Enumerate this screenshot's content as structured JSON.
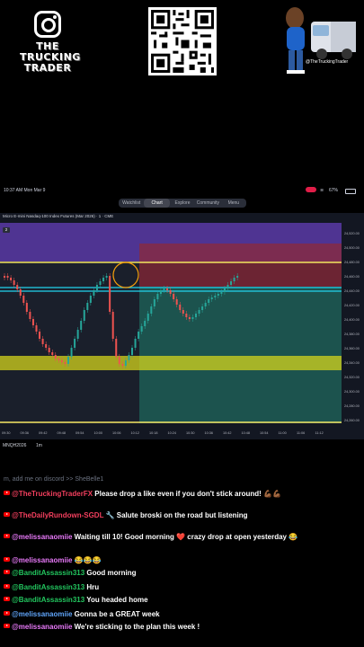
{
  "brand": {
    "line1": "THE",
    "line2": "TRUCKING",
    "line3": "TRADER",
    "handle": "@TheTruckingTrader"
  },
  "status_bar": {
    "time": "10:37 AM  Mon Mar 9",
    "battery": "67%"
  },
  "nav": {
    "tabs": [
      "Watchlist",
      "Chart",
      "Explore",
      "Community",
      "Menu"
    ],
    "active": "Chart"
  },
  "chart": {
    "title": "Micro E-mini Nasdaq-100 Index Futures (Mar 2026) · 1 · CME",
    "interval_badge": "2",
    "symbol": "MNQH2026",
    "timeframe": "1m",
    "price_labels": [
      "24,520.00",
      "24,500.00",
      "24,480.00",
      "24,460.00",
      "24,440.00",
      "24,420.00",
      "24,400.00",
      "24,380.00",
      "24,360.00",
      "24,340.00",
      "24,320.00",
      "24,300.00",
      "24,280.00",
      "24,260.00"
    ],
    "time_labels": [
      "09:30",
      "09:36",
      "09:42",
      "09:48",
      "09:54",
      "10:00",
      "10:06",
      "10:12",
      "10:18",
      "10:24",
      "10:30",
      "10:36",
      "10:42",
      "10:48",
      "10:54",
      "11:00",
      "11:06",
      "11:12"
    ],
    "colors": {
      "up": "#26a69a",
      "down": "#ef5350",
      "zone_purple": "#5b3aa6",
      "zone_red": "#8b2a3a",
      "zone_green": "#1e5e56",
      "line_yellow": "#f5e663",
      "line_cyan": "#22d3ee"
    }
  },
  "chat": [
    {
      "user": "",
      "text": "m, add me on discord >> SheBelle1",
      "color": ""
    },
    {
      "user": "@TheTruckingTraderFX",
      "text": "Please drop a like even if you don't stick around! 💪🏾💪🏾",
      "color": "u-r"
    },
    {
      "user": "@TheDailyRundown-SGDL",
      "text": "🔧 Salute broski on the road but listening",
      "color": "u-r"
    },
    {
      "user": "@melissanaomiie",
      "text": "Waiting till 10! Good morning ❤️ crazy drop at open yesterday 😂",
      "color": "u-p"
    },
    {
      "user": "@melissanaomiie",
      "text": "😂😂😂",
      "color": "u-p"
    },
    {
      "user": "@BanditAssassin313",
      "text": "Good morning",
      "color": "u-g"
    },
    {
      "user": "@BanditAssassin313",
      "text": "Hru",
      "color": "u-g"
    },
    {
      "user": "@BanditAssassin313",
      "text": "You headed home",
      "color": "u-g"
    },
    {
      "user": "@melissanaomiie",
      "text": "Gonna be a GREAT week",
      "color": "u-b"
    },
    {
      "user": "@melissanaomiie",
      "text": "We're sticking to the plan this week !",
      "color": "u-p"
    }
  ]
}
